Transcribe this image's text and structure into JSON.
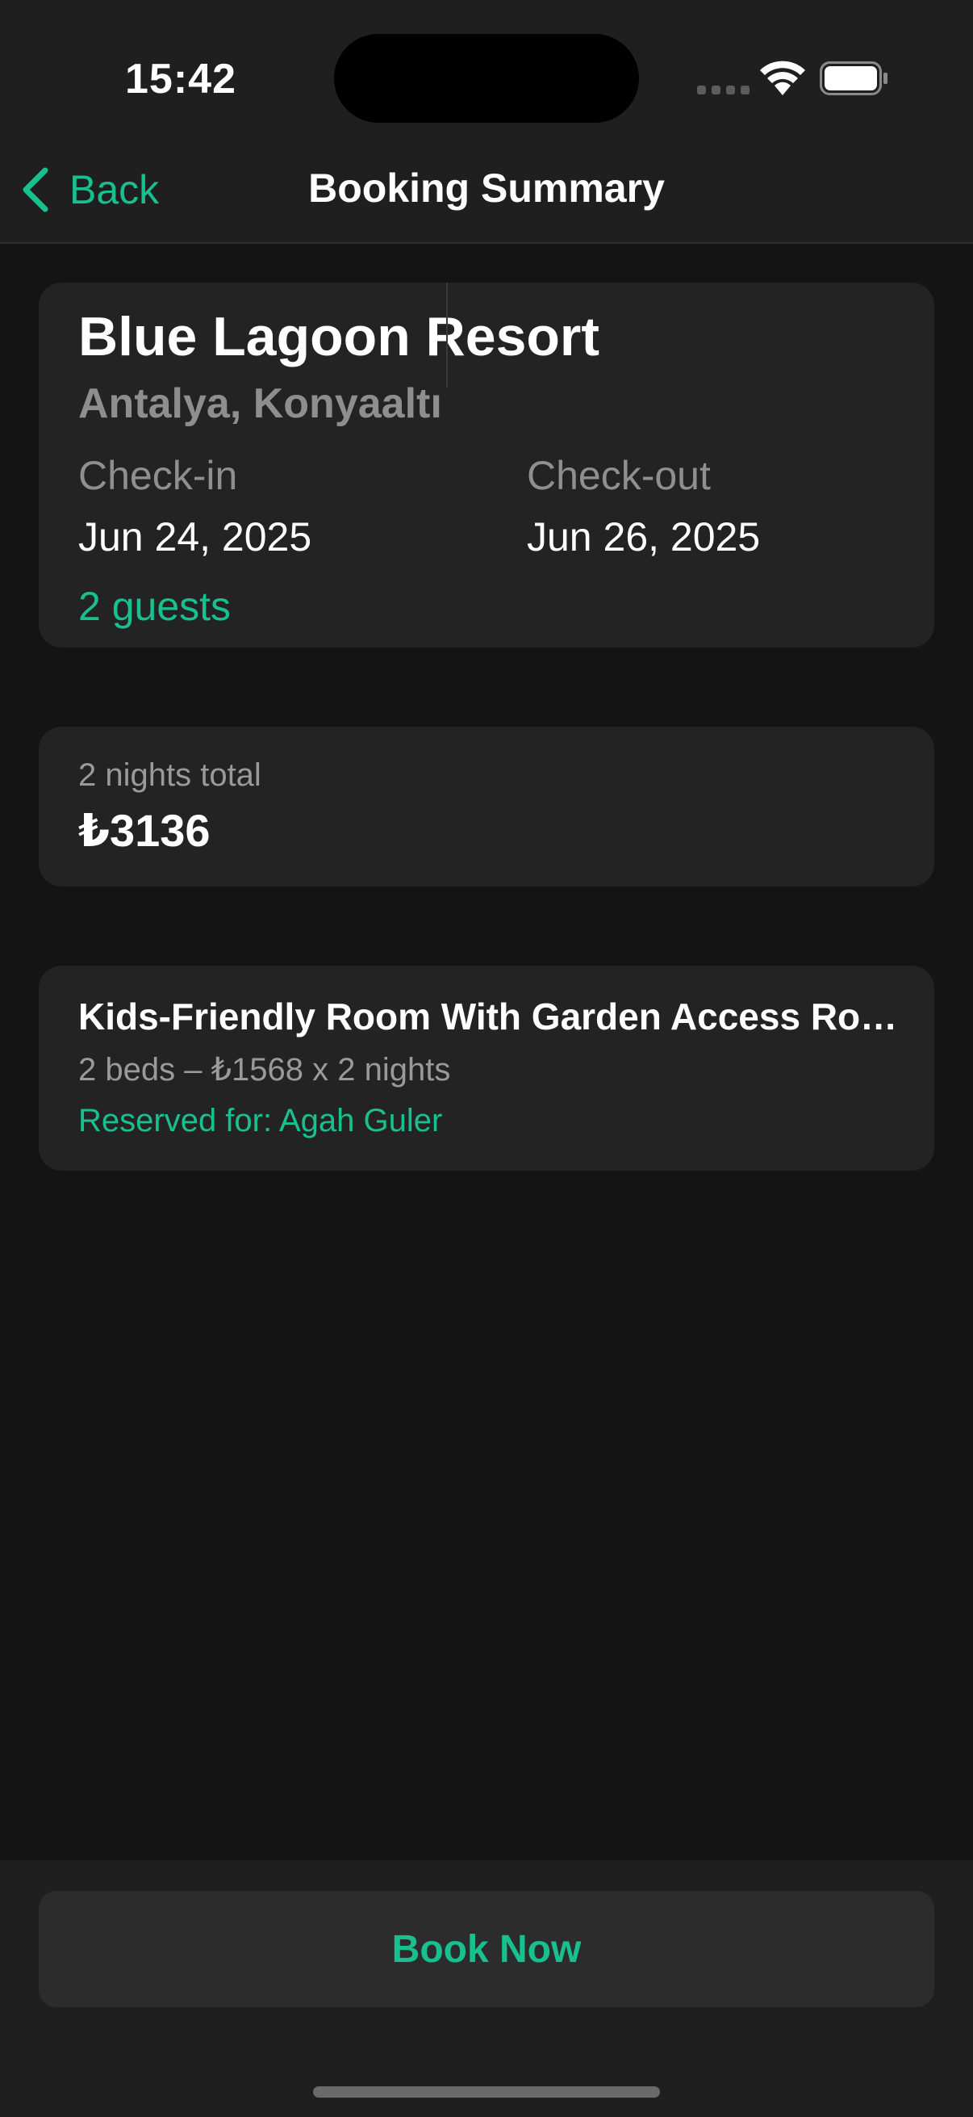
{
  "status_bar": {
    "time": "15:42",
    "icons": [
      "signal-dots-icon",
      "wifi-icon",
      "battery-icon"
    ]
  },
  "nav": {
    "back_label": "Back",
    "title": "Booking Summary"
  },
  "hotel": {
    "name": "Blue Lagoon Resort",
    "location": "Antalya, Konyaaltı",
    "check_in_label": "Check-in",
    "check_in_date": "Jun 24, 2025",
    "check_out_label": "Check-out",
    "check_out_date": "Jun 26, 2025",
    "guests": "2 guests"
  },
  "price": {
    "nights_label": "2 nights total",
    "total": "₺3136"
  },
  "room": {
    "name": "Kids-Friendly Room With Garden Access Room",
    "detail": "2 beds – ₺1568 x 2 nights",
    "reserved": "Reserved for: Agah Guler"
  },
  "footer": {
    "book_label": "Book Now"
  },
  "colors": {
    "accent": "#19c08f",
    "background": "#141414",
    "card": "#232323",
    "bar": "#1f1f1f",
    "muted_text": "#8e8e8e"
  }
}
